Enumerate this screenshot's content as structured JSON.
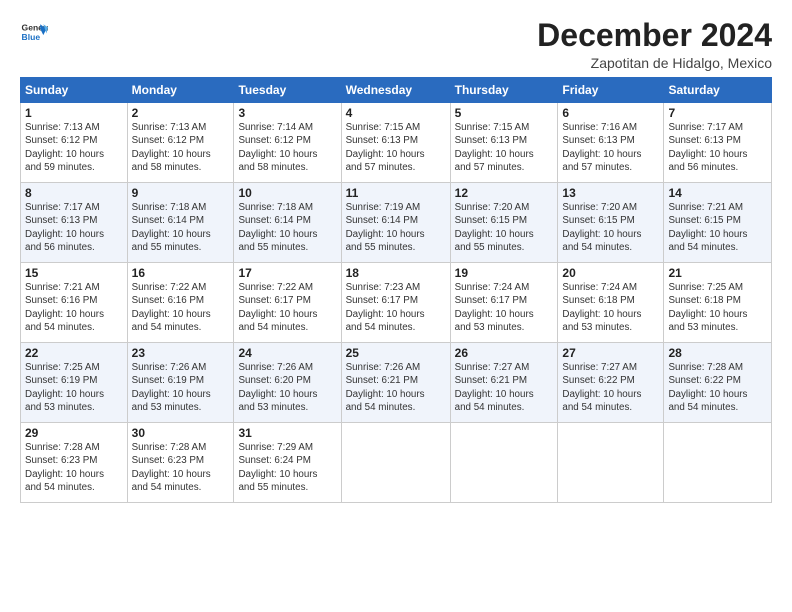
{
  "logo": {
    "line1": "General",
    "line2": "Blue"
  },
  "title": "December 2024",
  "subtitle": "Zapotitan de Hidalgo, Mexico",
  "weekdays": [
    "Sunday",
    "Monday",
    "Tuesday",
    "Wednesday",
    "Thursday",
    "Friday",
    "Saturday"
  ],
  "weeks": [
    [
      {
        "day": "1",
        "info": "Sunrise: 7:13 AM\nSunset: 6:12 PM\nDaylight: 10 hours\nand 59 minutes."
      },
      {
        "day": "2",
        "info": "Sunrise: 7:13 AM\nSunset: 6:12 PM\nDaylight: 10 hours\nand 58 minutes."
      },
      {
        "day": "3",
        "info": "Sunrise: 7:14 AM\nSunset: 6:12 PM\nDaylight: 10 hours\nand 58 minutes."
      },
      {
        "day": "4",
        "info": "Sunrise: 7:15 AM\nSunset: 6:13 PM\nDaylight: 10 hours\nand 57 minutes."
      },
      {
        "day": "5",
        "info": "Sunrise: 7:15 AM\nSunset: 6:13 PM\nDaylight: 10 hours\nand 57 minutes."
      },
      {
        "day": "6",
        "info": "Sunrise: 7:16 AM\nSunset: 6:13 PM\nDaylight: 10 hours\nand 57 minutes."
      },
      {
        "day": "7",
        "info": "Sunrise: 7:17 AM\nSunset: 6:13 PM\nDaylight: 10 hours\nand 56 minutes."
      }
    ],
    [
      {
        "day": "8",
        "info": "Sunrise: 7:17 AM\nSunset: 6:13 PM\nDaylight: 10 hours\nand 56 minutes."
      },
      {
        "day": "9",
        "info": "Sunrise: 7:18 AM\nSunset: 6:14 PM\nDaylight: 10 hours\nand 55 minutes."
      },
      {
        "day": "10",
        "info": "Sunrise: 7:18 AM\nSunset: 6:14 PM\nDaylight: 10 hours\nand 55 minutes."
      },
      {
        "day": "11",
        "info": "Sunrise: 7:19 AM\nSunset: 6:14 PM\nDaylight: 10 hours\nand 55 minutes."
      },
      {
        "day": "12",
        "info": "Sunrise: 7:20 AM\nSunset: 6:15 PM\nDaylight: 10 hours\nand 55 minutes."
      },
      {
        "day": "13",
        "info": "Sunrise: 7:20 AM\nSunset: 6:15 PM\nDaylight: 10 hours\nand 54 minutes."
      },
      {
        "day": "14",
        "info": "Sunrise: 7:21 AM\nSunset: 6:15 PM\nDaylight: 10 hours\nand 54 minutes."
      }
    ],
    [
      {
        "day": "15",
        "info": "Sunrise: 7:21 AM\nSunset: 6:16 PM\nDaylight: 10 hours\nand 54 minutes."
      },
      {
        "day": "16",
        "info": "Sunrise: 7:22 AM\nSunset: 6:16 PM\nDaylight: 10 hours\nand 54 minutes."
      },
      {
        "day": "17",
        "info": "Sunrise: 7:22 AM\nSunset: 6:17 PM\nDaylight: 10 hours\nand 54 minutes."
      },
      {
        "day": "18",
        "info": "Sunrise: 7:23 AM\nSunset: 6:17 PM\nDaylight: 10 hours\nand 54 minutes."
      },
      {
        "day": "19",
        "info": "Sunrise: 7:24 AM\nSunset: 6:17 PM\nDaylight: 10 hours\nand 53 minutes."
      },
      {
        "day": "20",
        "info": "Sunrise: 7:24 AM\nSunset: 6:18 PM\nDaylight: 10 hours\nand 53 minutes."
      },
      {
        "day": "21",
        "info": "Sunrise: 7:25 AM\nSunset: 6:18 PM\nDaylight: 10 hours\nand 53 minutes."
      }
    ],
    [
      {
        "day": "22",
        "info": "Sunrise: 7:25 AM\nSunset: 6:19 PM\nDaylight: 10 hours\nand 53 minutes."
      },
      {
        "day": "23",
        "info": "Sunrise: 7:26 AM\nSunset: 6:19 PM\nDaylight: 10 hours\nand 53 minutes."
      },
      {
        "day": "24",
        "info": "Sunrise: 7:26 AM\nSunset: 6:20 PM\nDaylight: 10 hours\nand 53 minutes."
      },
      {
        "day": "25",
        "info": "Sunrise: 7:26 AM\nSunset: 6:21 PM\nDaylight: 10 hours\nand 54 minutes."
      },
      {
        "day": "26",
        "info": "Sunrise: 7:27 AM\nSunset: 6:21 PM\nDaylight: 10 hours\nand 54 minutes."
      },
      {
        "day": "27",
        "info": "Sunrise: 7:27 AM\nSunset: 6:22 PM\nDaylight: 10 hours\nand 54 minutes."
      },
      {
        "day": "28",
        "info": "Sunrise: 7:28 AM\nSunset: 6:22 PM\nDaylight: 10 hours\nand 54 minutes."
      }
    ],
    [
      {
        "day": "29",
        "info": "Sunrise: 7:28 AM\nSunset: 6:23 PM\nDaylight: 10 hours\nand 54 minutes."
      },
      {
        "day": "30",
        "info": "Sunrise: 7:28 AM\nSunset: 6:23 PM\nDaylight: 10 hours\nand 54 minutes."
      },
      {
        "day": "31",
        "info": "Sunrise: 7:29 AM\nSunset: 6:24 PM\nDaylight: 10 hours\nand 55 minutes."
      },
      null,
      null,
      null,
      null
    ]
  ]
}
